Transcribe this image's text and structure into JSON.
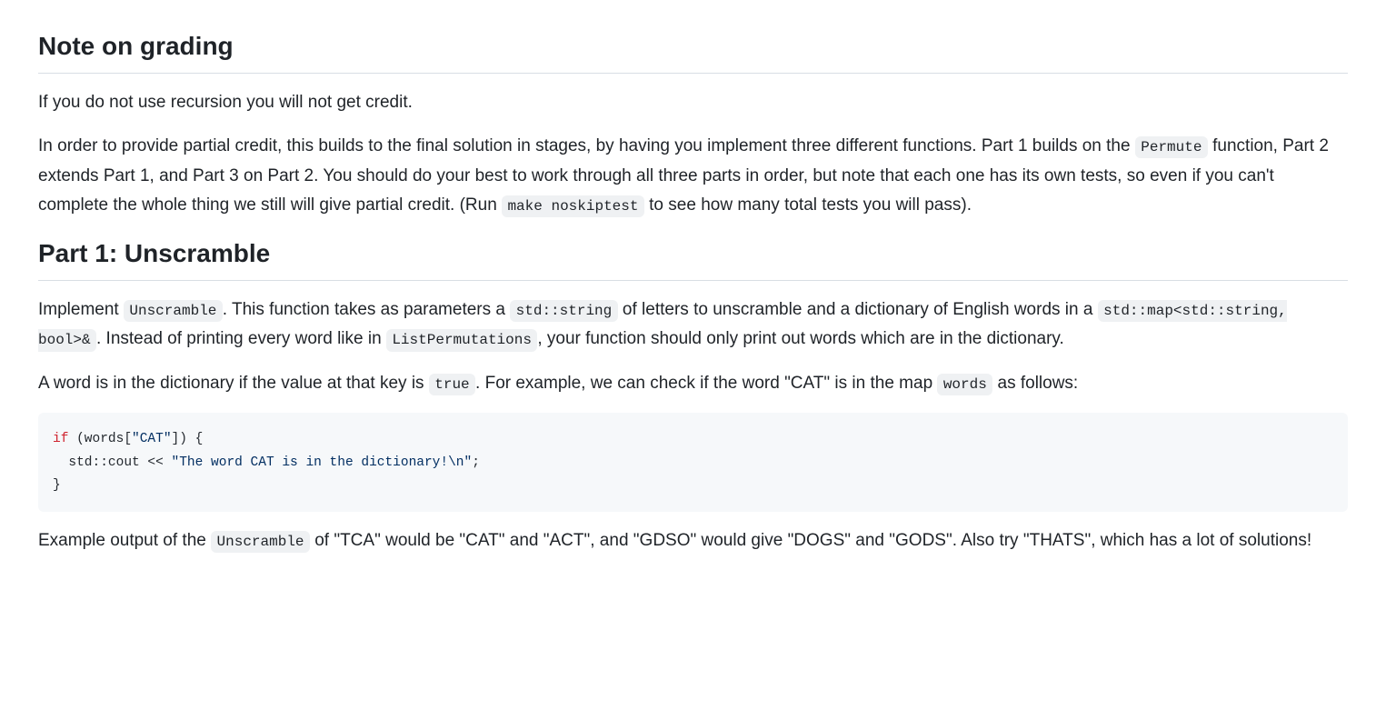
{
  "sections": {
    "grading": {
      "heading": "Note on grading",
      "p1": "If you do not use recursion you will not get credit.",
      "p2_parts": {
        "t0": "In order to provide partial credit, this builds to the final solution in stages, by having you implement three different functions. Part 1 builds on the ",
        "c0": "Permute",
        "t1": " function, Part 2 extends Part 1, and Part 3 on Part 2. You should do your best to work through all three parts in order, but note that each one has its own tests, so even if you can't complete the whole thing we still will give partial credit. (Run ",
        "c1": "make noskiptest",
        "t2": " to see how many total tests you will pass)."
      }
    },
    "part1": {
      "heading": "Part 1: Unscramble",
      "p1_parts": {
        "t0": "Implement ",
        "c0": "Unscramble",
        "t1": ". This function takes as parameters a ",
        "c1": "std::string",
        "t2": " of letters to unscramble and a dictionary of English words in a ",
        "c2": "std::map<std::string, bool>&",
        "t3": ". Instead of printing every word like in ",
        "c3": "ListPermutations",
        "t4": ", your function should only print out words which are in the dictionary."
      },
      "p2_parts": {
        "t0": "A word is in the dictionary if the value at that key is ",
        "c0": "true",
        "t1": ". For example, we can check if the word \"CAT\" is in the map ",
        "c1": "words",
        "t2": " as follows:"
      },
      "code": {
        "l1_kw": "if",
        "l1_rest": " (words[",
        "l1_str": "\"CAT\"",
        "l1_tail": "]) {",
        "l2_indent": "  std::cout << ",
        "l2_str": "\"The word CAT is in the dictionary!\\n\"",
        "l2_tail": ";",
        "l3": "}"
      },
      "p3_parts": {
        "t0": "Example output of the ",
        "c0": "Unscramble",
        "t1": " of \"TCA\" would be \"CAT\" and \"ACT\", and \"GDSO\" would give \"DOGS\" and \"GODS\". Also try \"THATS\", which has a lot of solutions!"
      }
    }
  }
}
